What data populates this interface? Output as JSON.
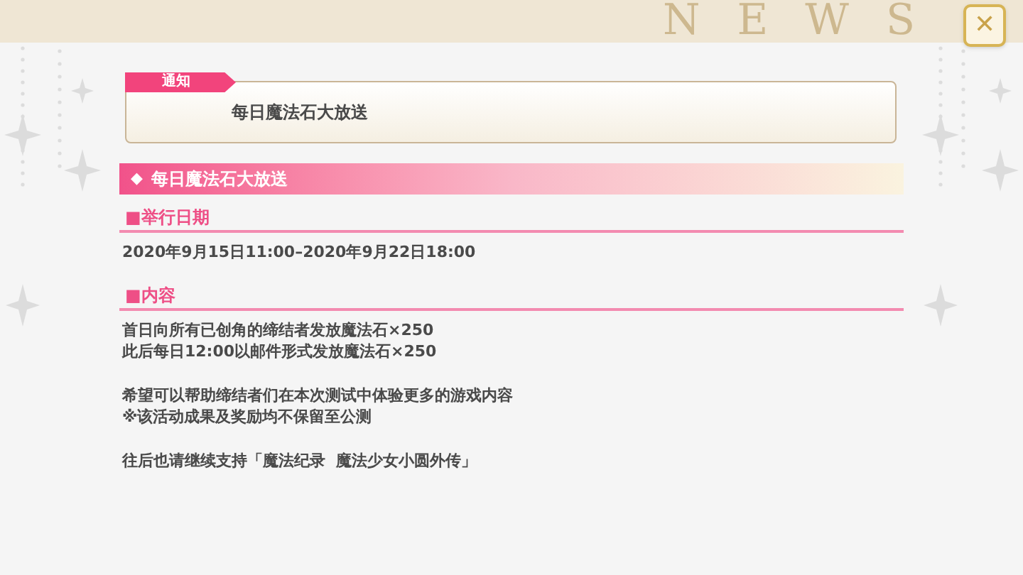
{
  "header": {
    "watermark": "NEWS",
    "close_label": "✕"
  },
  "notice": {
    "tag": "通知",
    "title": "每日魔法石大放送"
  },
  "section": {
    "marker": "◆",
    "title": "每日魔法石大放送"
  },
  "blocks": [
    {
      "heading": "■举行日期",
      "paragraphs": [
        [
          "2020年9月15日11:00–2020年9月22日18:00"
        ]
      ]
    },
    {
      "heading": "■内容",
      "paragraphs": [
        [
          "首日向所有已创角的缔结者发放魔法石×250",
          "此后每日12:00以邮件形式发放魔法石×250"
        ],
        [
          "希望可以帮助缔结者们在本次测试中体验更多的游戏内容",
          "※该活动成果及奖励均不保留至公测"
        ],
        [
          "往后也请继续支持「魔法纪录  魔法少女小圆外传」"
        ]
      ]
    }
  ]
}
